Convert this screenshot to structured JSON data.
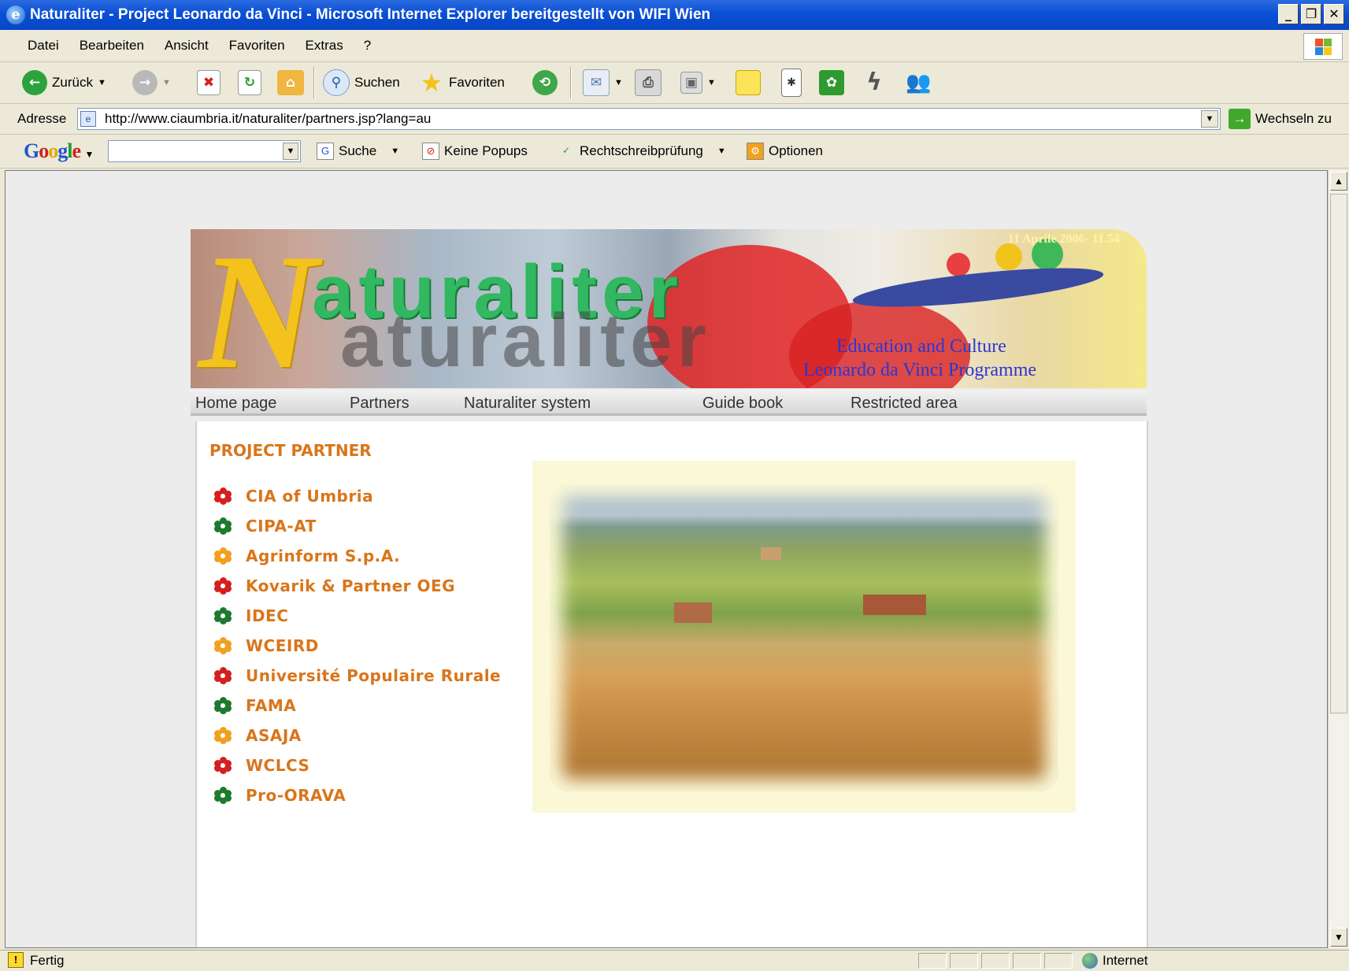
{
  "window": {
    "title": "Naturaliter - Project Leonardo da Vinci - Microsoft Internet Explorer bereitgestellt von WIFI Wien",
    "controls": [
      "_",
      "̅",
      "X"
    ]
  },
  "menu": [
    "Datei",
    "Bearbeiten",
    "Ansicht",
    "Favoriten",
    "Extras",
    "?"
  ],
  "toolbar": {
    "back_label": "Zurück",
    "search_label": "Suchen",
    "favorites_label": "Favoriten"
  },
  "address": {
    "label": "Adresse",
    "url": "http://www.ciaumbria.it/naturaliter/partners.jsp?lang=au",
    "go_label": "Wechseln zu"
  },
  "google_bar": {
    "logo": [
      "G",
      "o",
      "o",
      "g",
      "l",
      "e"
    ],
    "search_label": "Suche",
    "popups_label": "Keine Popups",
    "spell_label": "Rechtschreibprüfung",
    "options_label": "Optionen"
  },
  "banner": {
    "date": "11 Aprile 2006- 11.54",
    "logo_n": "N",
    "logo_rest": "aturaliter",
    "ec_line1": "Education and Culture",
    "ec_line2": "Leonardo da Vinci Programme"
  },
  "nav": [
    "Home page",
    "Partners",
    "Naturaliter system",
    "Guide book",
    "Restricted area"
  ],
  "page": {
    "title": "PROJECT PARTNER",
    "partners": [
      {
        "name": "CIA of Umbria",
        "color": "#d42020"
      },
      {
        "name": "CIPA-AT",
        "color": "#1e7a2e"
      },
      {
        "name": "Agrinform S.p.A.",
        "color": "#f2a020"
      },
      {
        "name": "Kovarik & Partner OEG",
        "color": "#d42020"
      },
      {
        "name": "IDEC",
        "color": "#1e7a2e"
      },
      {
        "name": "WCEIRD",
        "color": "#f2a020"
      },
      {
        "name": "Université Populaire Rurale",
        "color": "#d42020"
      },
      {
        "name": "FAMA",
        "color": "#1e7a2e"
      },
      {
        "name": "ASAJA",
        "color": "#f2a020"
      },
      {
        "name": "WCLCS",
        "color": "#d42020"
      },
      {
        "name": "Pro-ORAVA",
        "color": "#1e7a2e"
      }
    ]
  },
  "status": {
    "text": "Fertig",
    "zone": "Internet"
  }
}
